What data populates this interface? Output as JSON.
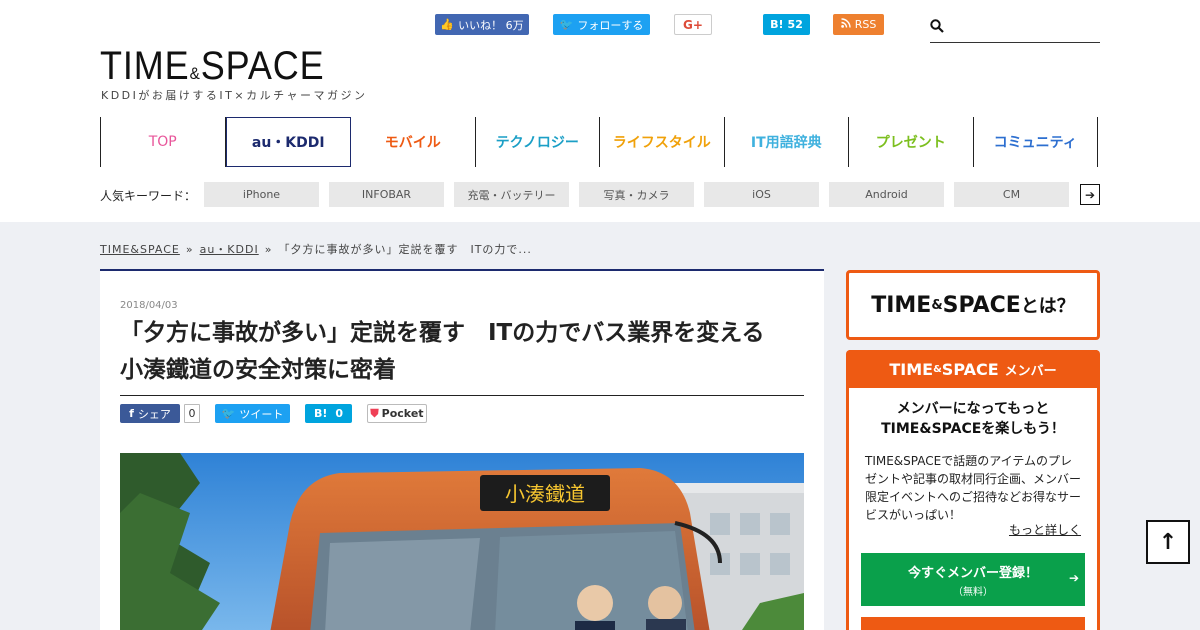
{
  "social": {
    "like": "いいね！ 6万",
    "follow": "フォローする",
    "gplus": "G+",
    "hatena": "52",
    "hatena_icon": "B!",
    "rss": "RSS"
  },
  "search": {
    "placeholder": ""
  },
  "logo": {
    "main": "TIME",
    "amp": "&",
    "rest": "SPACE",
    "tagline": "KDDIがお届けするIT×カルチャーマガジン"
  },
  "nav": [
    {
      "label": "TOP",
      "color": "#e8559a"
    },
    {
      "label": "au・KDDI",
      "color": "#1c2a6e"
    },
    {
      "label": "モバイル",
      "color": "#ee5a13"
    },
    {
      "label": "テクノロジー",
      "color": "#1b9fc6"
    },
    {
      "label": "ライフスタイル",
      "color": "#f0a10a"
    },
    {
      "label": "IT用語辞典",
      "color": "#3fb1de"
    },
    {
      "label": "プレゼント",
      "color": "#7cbf1e"
    },
    {
      "label": "コミュニティ",
      "color": "#2d6fd0"
    }
  ],
  "keywords": {
    "label": "人気キーワード：",
    "tags": [
      "iPhone",
      "INFOBAR",
      "充電・バッテリー",
      "写真・カメラ",
      "iOS",
      "Android",
      "CM"
    ],
    "more": "➔"
  },
  "breadcrumb": {
    "home": "TIME&SPACE",
    "sep": "»",
    "category": "au・KDDI",
    "current": "「夕方に事故が多い」定説を覆す　ITの力で..."
  },
  "article": {
    "date": "2018/04/03",
    "title_line1": "「夕方に事故が多い」定説を覆す　ITの力でバス業界を変える",
    "title_line2": "小湊鐵道の安全対策に密着",
    "share_fb": "シェア",
    "share_fb_count": "0",
    "share_tw": "ツイート",
    "share_hb": "0",
    "share_hb_icon": "B!",
    "share_pocket": "Pocket",
    "bus_sign": "小湊鐵道"
  },
  "sidebar": {
    "about_main": "TIME",
    "about_amp": "&",
    "about_rest": "SPACE",
    "about_suffix": "とは？",
    "member_head_main": "TIME",
    "member_head_amp": "&",
    "member_head_rest": "SPACE",
    "member_head_suffix": "メンバー",
    "member_title1": "メンバーになってもっと",
    "member_title2": "TIME&SPACEを楽しもう！",
    "member_desc": "TIME&SPACEで話題のアイテムのプレゼントや記事の取材同行企画、メンバー限定イベントへのご招待などお得なサービスがいっぱい！",
    "member_more": "もっと詳しく",
    "register_label": "今すぐメンバー登録！",
    "register_sub": "（無料）",
    "register_arrow": "➔"
  },
  "totop": "↑",
  "colors": {
    "accent": "#ee5a13",
    "navy": "#1c2a6e",
    "green": "#0aa04b"
  }
}
